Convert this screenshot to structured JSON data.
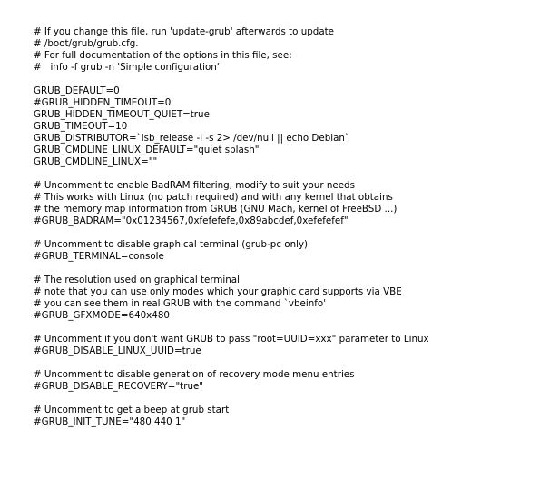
{
  "file": {
    "lines": [
      "# If you change this file, run 'update-grub' afterwards to update",
      "# /boot/grub/grub.cfg.",
      "# For full documentation of the options in this file, see:",
      "#   info -f grub -n 'Simple configuration'",
      "",
      "GRUB_DEFAULT=0",
      "#GRUB_HIDDEN_TIMEOUT=0",
      "GRUB_HIDDEN_TIMEOUT_QUIET=true",
      "GRUB_TIMEOUT=10",
      "GRUB_DISTRIBUTOR=`lsb_release -i -s 2> /dev/null || echo Debian`",
      "GRUB_CMDLINE_LINUX_DEFAULT=\"quiet splash\"",
      "GRUB_CMDLINE_LINUX=\"\"",
      "",
      "# Uncomment to enable BadRAM filtering, modify to suit your needs",
      "# This works with Linux (no patch required) and with any kernel that obtains",
      "# the memory map information from GRUB (GNU Mach, kernel of FreeBSD ...)",
      "#GRUB_BADRAM=\"0x01234567,0xfefefefe,0x89abcdef,0xefefefef\"",
      "",
      "# Uncomment to disable graphical terminal (grub-pc only)",
      "#GRUB_TERMINAL=console",
      "",
      "# The resolution used on graphical terminal",
      "# note that you can use only modes which your graphic card supports via VBE",
      "# you can see them in real GRUB with the command `vbeinfo'",
      "#GRUB_GFXMODE=640x480",
      "",
      "# Uncomment if you don't want GRUB to pass \"root=UUID=xxx\" parameter to Linux",
      "#GRUB_DISABLE_LINUX_UUID=true",
      "",
      "# Uncomment to disable generation of recovery mode menu entries",
      "#GRUB_DISABLE_RECOVERY=\"true\"",
      "",
      "# Uncomment to get a beep at grub start",
      "#GRUB_INIT_TUNE=\"480 440 1\""
    ]
  }
}
